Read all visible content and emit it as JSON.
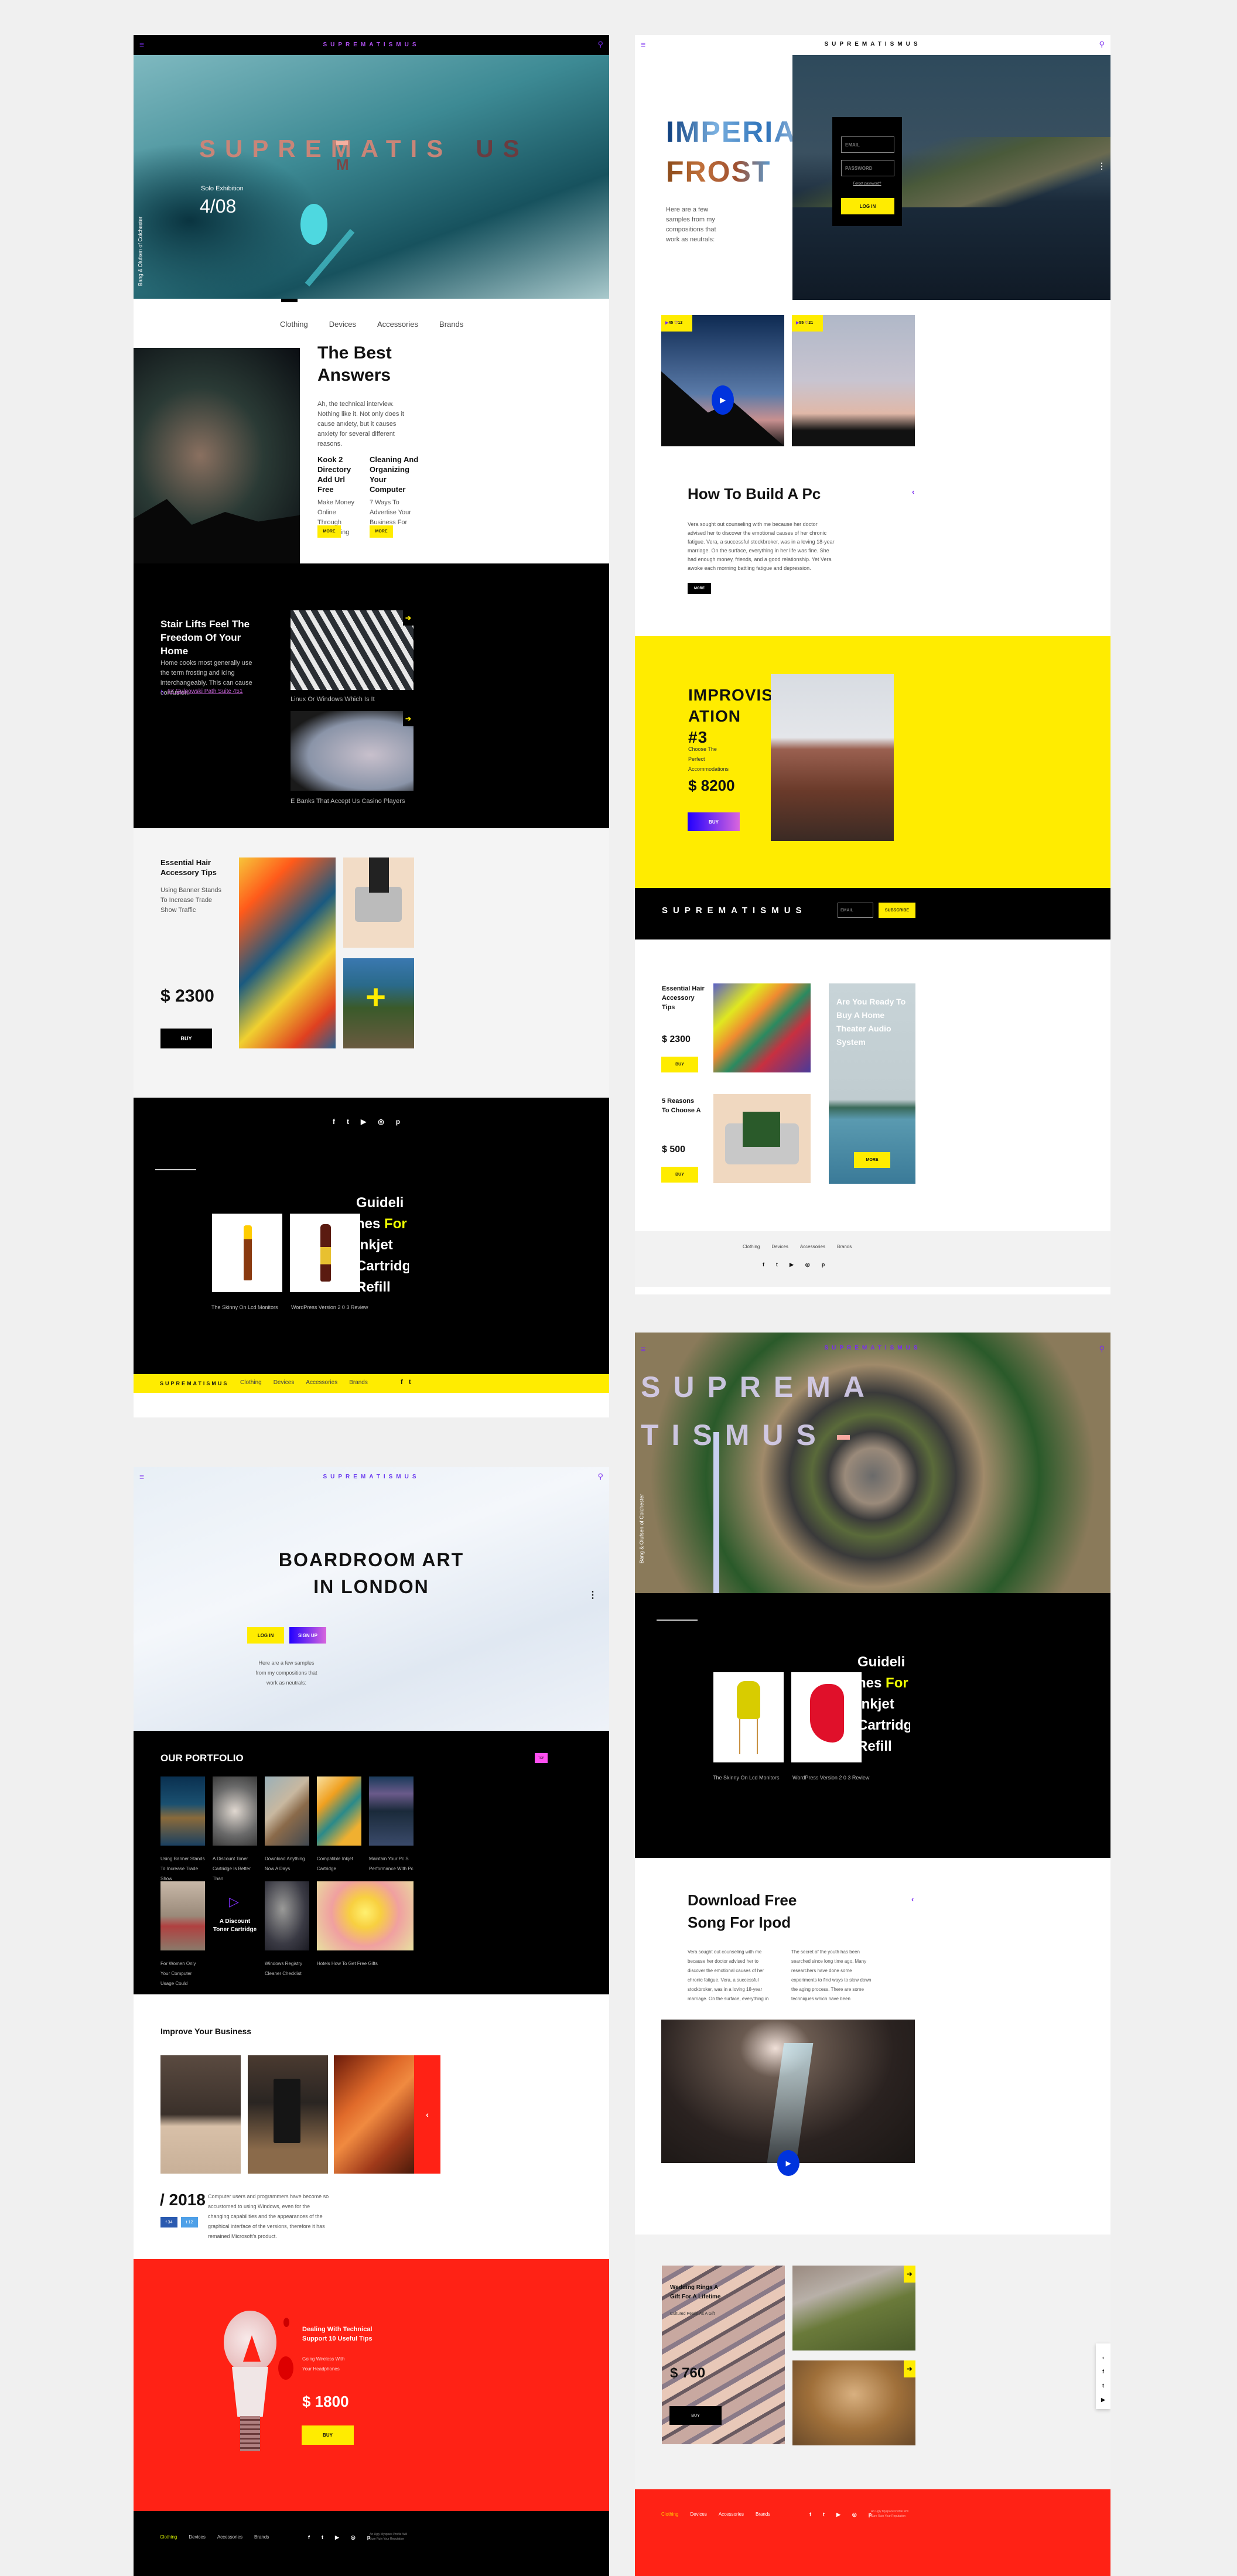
{
  "brand": "SUPREMATISMUS",
  "colors": {
    "yellow": "#ffec00",
    "red": "#ff2215",
    "purple": "#7a2cf0",
    "blue": "#0033dd",
    "pink": "#ff4ff0"
  },
  "nav": [
    "Clothing",
    "Devices",
    "Accessories",
    "Brands"
  ],
  "p1": {
    "hero_title": "SUPREMATIS",
    "hero_title_end": "US",
    "hero_title_m": "M",
    "subtitle": "Solo Exhibition",
    "date": "4/08",
    "side_caption": "Bang & Olufsen of Colchester",
    "best_title": "The Best Answers",
    "best_text": "Ah, the technical interview. Nothing like it. Not only does it cause anxiety, but it causes anxiety for several different reasons.",
    "cards": [
      {
        "title": "Kook 2 Directory Add Url Free",
        "text": "Make Money Online Through Advertising",
        "btn": "MORE"
      },
      {
        "title": "Cleaning And Organizing Your Computer",
        "text": "7 Ways To Advertise Your Business For Free",
        "btn": "MORE"
      }
    ],
    "stair_title": "Stair Lifts Feel The Freedom Of Your Home",
    "stair_text": "Home cooks most generally use the term frosting and icing interchangeably. This can cause confusion.",
    "address": "67 Gulgowski Path Suite 451",
    "thumbs": [
      "Linux Or Windows Which Is It",
      "E Banks That Accept Us Casino Players"
    ],
    "hair_title": "Essential Hair Accessory Tips",
    "hair_text": "Using Banner Stands To Increase Trade Show Traffic",
    "price": "$ 2300",
    "buy": "BUY",
    "products": [
      "The Skinny On Lcd Monitors",
      "WordPress Version 2 0 3 Review"
    ],
    "guide_a": "Guideli nes ",
    "guide_for": "For",
    "guide_b": " Inkjet Cartridge Refill"
  },
  "p2": {
    "title1": "IMPERIAL",
    "title2": "FROST",
    "text": "Here are a few samples from my compositions that work as neutrals:",
    "email_placeholder": "EMAIL",
    "password_placeholder": "PASSWORD",
    "forgot": "Forgot password?",
    "login": "LOG IN",
    "stats": [
      {
        "views": "45",
        "likes": "12"
      },
      {
        "views": "55",
        "likes": "21"
      }
    ],
    "pc_title": "How To Build A Pc",
    "pc_text": "Vera sought out counseling with me because her doctor advised her to discover the emotional causes of her chronic fatigue. Vera, a successful stockbroker, was in a loving 18-year marriage. On the surface, everything in her life was fine. She had enough money, friends, and a good relationship. Yet Vera awoke each morning battling fatigue and depression.",
    "more": "MORE",
    "impro_title": "IMPROVIS ATION #3",
    "impro_text": "Choose The Perfect Accommodations",
    "impro_price": "$ 8200",
    "buy": "BUY",
    "subscribe_placeholder": "EMAIL",
    "subscribe": "SUBSCRIBE",
    "items": [
      {
        "title": "Essential Hair Accessory Tips",
        "price": "$ 2300",
        "btn": "BUY"
      },
      {
        "title": "5 Reasons To Choose A",
        "price": "$ 500",
        "btn": "BUY"
      }
    ],
    "promo": "Are You Ready To Buy A Home Theater Audio System",
    "promo_btn": "MORE"
  },
  "p3": {
    "title": "BOARDROOM ART IN LONDON",
    "login": "LOG IN",
    "signup": "SIGN UP",
    "text": "Here are a few samples from my compositions that work as neutrals:",
    "portfolio": "OUR PORTFOLIO",
    "top": "TOP",
    "grid": [
      "Using Banner Stands To Increase Trade Show",
      "A Discount Toner Cartridge Is Better Than",
      "Download Anything Now A Days",
      "Compatible Inkjet Cartridge",
      "Maintain Your Pc S Performance With Pc",
      "For Women Only Your Computer Usage Could",
      "",
      "Windows Registry Cleaner Checklist",
      "Hotels How To Get Free Gifts"
    ],
    "feature": "A Discount Toner Cartridge",
    "improve": "Improve Your Business",
    "year": "/ 2018",
    "fb": "34",
    "tw": "12",
    "year_text": "Computer users and programmers have become so accustomed to using Windows, even for the changing capabilities and the appearances of the graphical interface of the versions, therefore it has remained Microsoft's product.",
    "deal_title": "Dealing With Technical Support 10 Useful Tips",
    "deal_text": "Going Wireless With Your Headphones",
    "deal_price": "$ 1800",
    "buy": "BUY",
    "footer_note": "An Ugly Myspace Profile Will Sure Ruin Your Reputation"
  },
  "p4": {
    "song_title": "Download Free Song For Ipod",
    "col1": "Vera sought out counseling with me because her doctor advised her to discover the emotional causes of her chronic fatigue. Vera, a successful stockbroker, was in a loving 18-year marriage. On the surface, everything in her life was fine. She had",
    "col2": "The secret of the youth has been searched since long time ago. Many researchers have done some experiments to find ways to slow down the aging process. There are some techniques which have been implemented, but the most important",
    "ring_title": "Wedding Rings A Gift For A Lifetime",
    "ring_text": "Cultured Pearls As A Gift",
    "ring_price": "$ 760",
    "buy": "BUY"
  }
}
